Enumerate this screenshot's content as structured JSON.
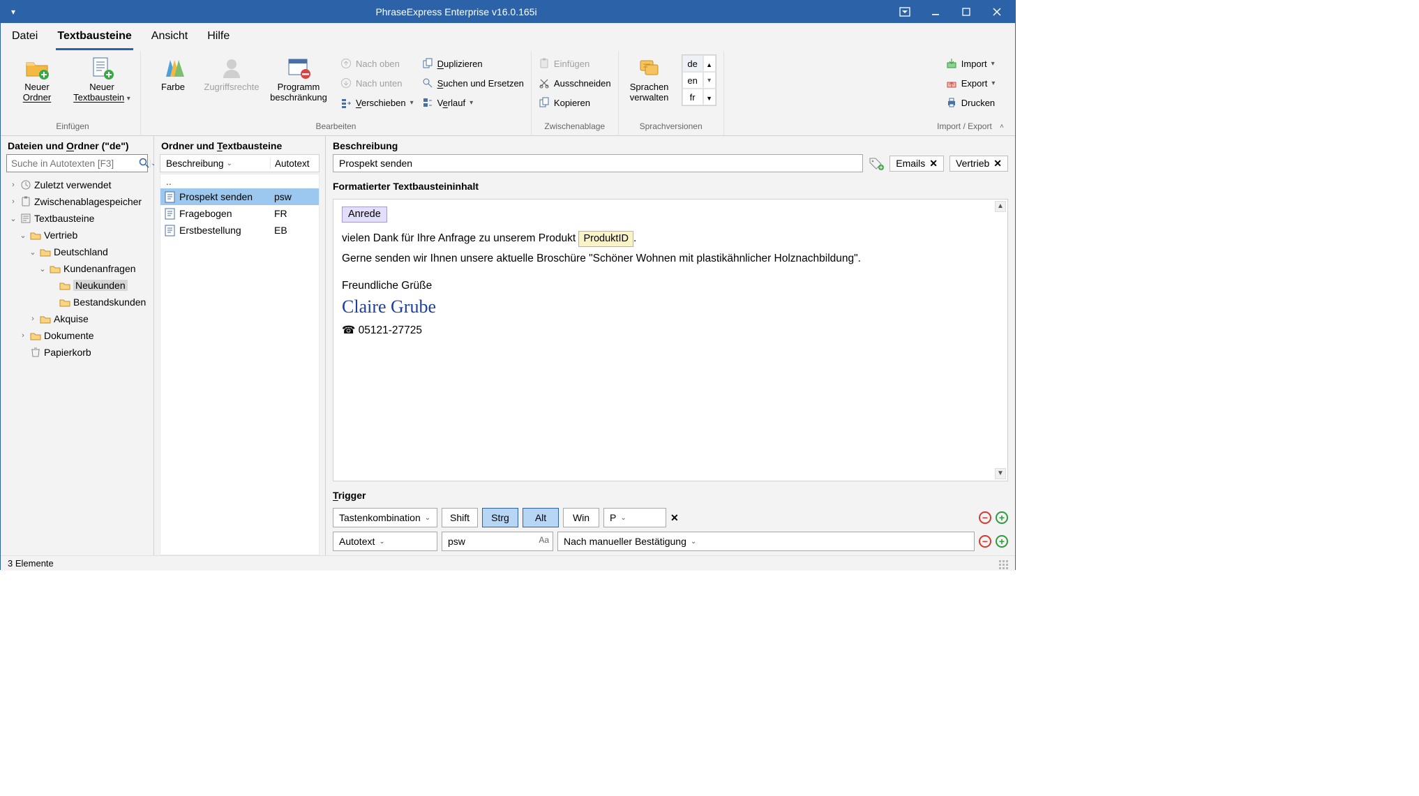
{
  "title": "PhraseExpress Enterprise v16.0.165i",
  "menu": {
    "datei": "Datei",
    "textbausteine": "Textbausteine",
    "ansicht": "Ansicht",
    "hilfe": "Hilfe"
  },
  "ribbon": {
    "einfuegen": {
      "group": "Einfügen",
      "neuer_ordner_l1": "Neuer",
      "neuer_ordner_l2": "Ordner",
      "neuer_tb_l1": "Neuer",
      "neuer_tb_l2": "Textbaustein"
    },
    "farbe": "Farbe",
    "zugriffsrechte": "Zugriffsrechte",
    "programm_l1": "Programm",
    "programm_l2": "beschränkung",
    "bearbeiten": {
      "group": "Bearbeiten",
      "nach_oben": "Nach oben",
      "nach_unten": "Nach unten",
      "verschieben": "Verschieben",
      "duplizieren": "Duplizieren",
      "suchen": "Suchen und Ersetzen",
      "verlauf": "Verlauf"
    },
    "zwischenablage": {
      "group": "Zwischenablage",
      "einfuegen": "Einfügen",
      "ausschneiden": "Ausschneiden",
      "kopieren": "Kopieren"
    },
    "sprach": {
      "group": "Sprachversionen",
      "verwalten_l1": "Sprachen",
      "verwalten_l2": "verwalten",
      "de": "de",
      "en": "en",
      "fr": "fr"
    },
    "impexp": {
      "group": "Import / Export",
      "import": "Import",
      "export": "Export",
      "drucken": "Drucken"
    }
  },
  "left": {
    "hdr": "Dateien und Ordner (\"de\")",
    "search_ph": "Suche in Autotexten [F3]",
    "zuletzt": "Zuletzt verwendet",
    "zwischen": "Zwischenablagespeicher",
    "textbausteine": "Textbausteine",
    "vertrieb": "Vertrieb",
    "deutschland": "Deutschland",
    "kundenanfragen": "Kundenanfragen",
    "neukunden": "Neukunden",
    "bestandskunden": "Bestandskunden",
    "akquise": "Akquise",
    "dokumente": "Dokumente",
    "papierkorb": "Papierkorb"
  },
  "mid": {
    "hdr": "Ordner und Textbausteine",
    "col1": "Beschreibung",
    "col2": "Autotext",
    "up": "..",
    "rows": [
      {
        "name": "Prospekt senden",
        "auto": "psw"
      },
      {
        "name": "Fragebogen",
        "auto": "FR"
      },
      {
        "name": "Erstbestellung",
        "auto": "EB"
      }
    ]
  },
  "right": {
    "hdr_desc": "Beschreibung",
    "desc": "Prospekt senden",
    "chip_emails": "Emails",
    "chip_vertrieb": "Vertrieb",
    "hdr_content": "Formatierter Textbausteininhalt",
    "anrede": "Anrede",
    "line1": "vielen Dank für Ihre Anfrage zu unserem Produkt ",
    "produktid": "ProduktID",
    "line1_end": ".",
    "line2": "Gerne senden wir Ihnen unsere aktuelle Broschüre \"Schöner Wohnen mit plastikähnlicher Holznachbildung\".",
    "gruss": "Freundliche Grüße",
    "sig": "Claire Grube",
    "tel": "05121-27725",
    "hdr_trigger": "Trigger",
    "t_type": "Tastenkombination",
    "shift": "Shift",
    "strg": "Strg",
    "alt": "Alt",
    "win": "Win",
    "key": "P",
    "a_type": "Autotext",
    "a_val": "psw",
    "a_mode": "Nach manueller Bestätigung"
  },
  "status": "3 Elemente"
}
